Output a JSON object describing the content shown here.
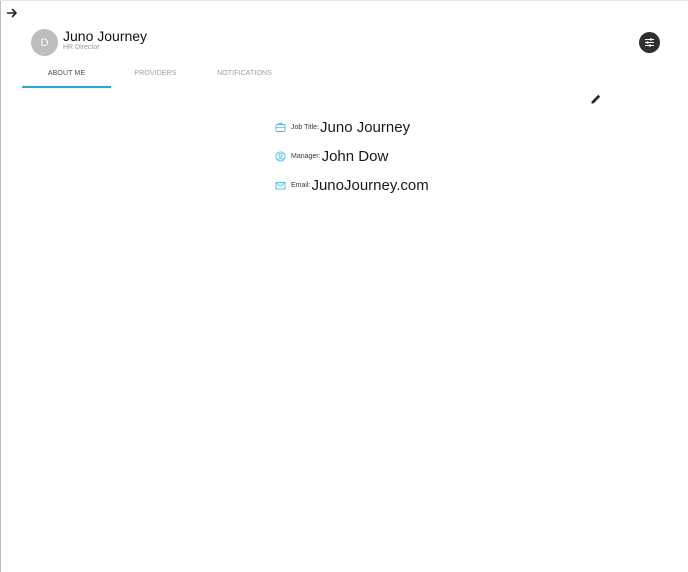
{
  "app": {
    "back_icon": "arrow-right-icon"
  },
  "profile": {
    "avatar_initial": "D",
    "name": "Juno Journey",
    "role": "HR Director"
  },
  "header": {
    "settings_icon": "sliders-icon"
  },
  "tabs": [
    {
      "label": "ABOUT ME",
      "active": true
    },
    {
      "label": "PROVIDERS",
      "active": false
    },
    {
      "label": "NOTIFICATIONS",
      "active": false
    }
  ],
  "about": {
    "edit_icon": "pencil-icon",
    "fields": [
      {
        "icon": "briefcase-icon",
        "label": "Job Title:",
        "value": "Juno Journey"
      },
      {
        "icon": "person-circle-icon",
        "label": "Manager:",
        "value": "John Dow"
      },
      {
        "icon": "envelope-icon",
        "label": "Email:",
        "value": "JunoJourney.com"
      }
    ]
  },
  "colors": {
    "accent": "#29a8d6",
    "icon_accent": "#4fb9dc",
    "avatar_bg": "#bdbdbd",
    "settings_bg": "#2f2f2f"
  }
}
